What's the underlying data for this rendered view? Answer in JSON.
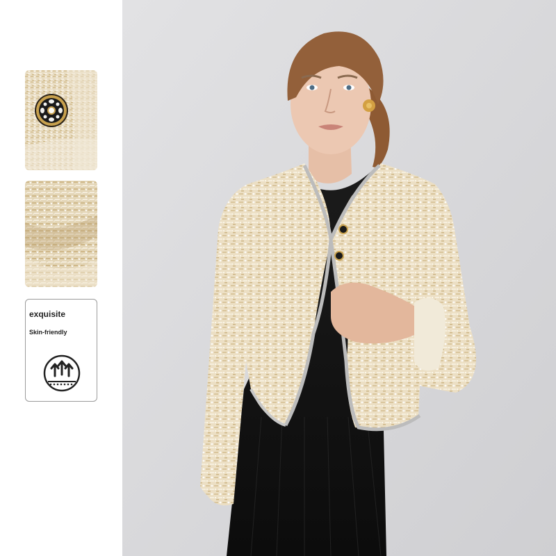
{
  "feature": {
    "title": "exquisite",
    "subtitle": "Skin-friendly",
    "icon": "breathable-arrows-icon"
  },
  "thumbnails": [
    {
      "icon": "fabric-button-closeup"
    },
    {
      "icon": "fabric-texture-closeup"
    }
  ],
  "colors": {
    "fabric": "#e9dcc0",
    "dress": "#141414",
    "background": "#d9d9db",
    "card_border": "#9a9a9a"
  }
}
